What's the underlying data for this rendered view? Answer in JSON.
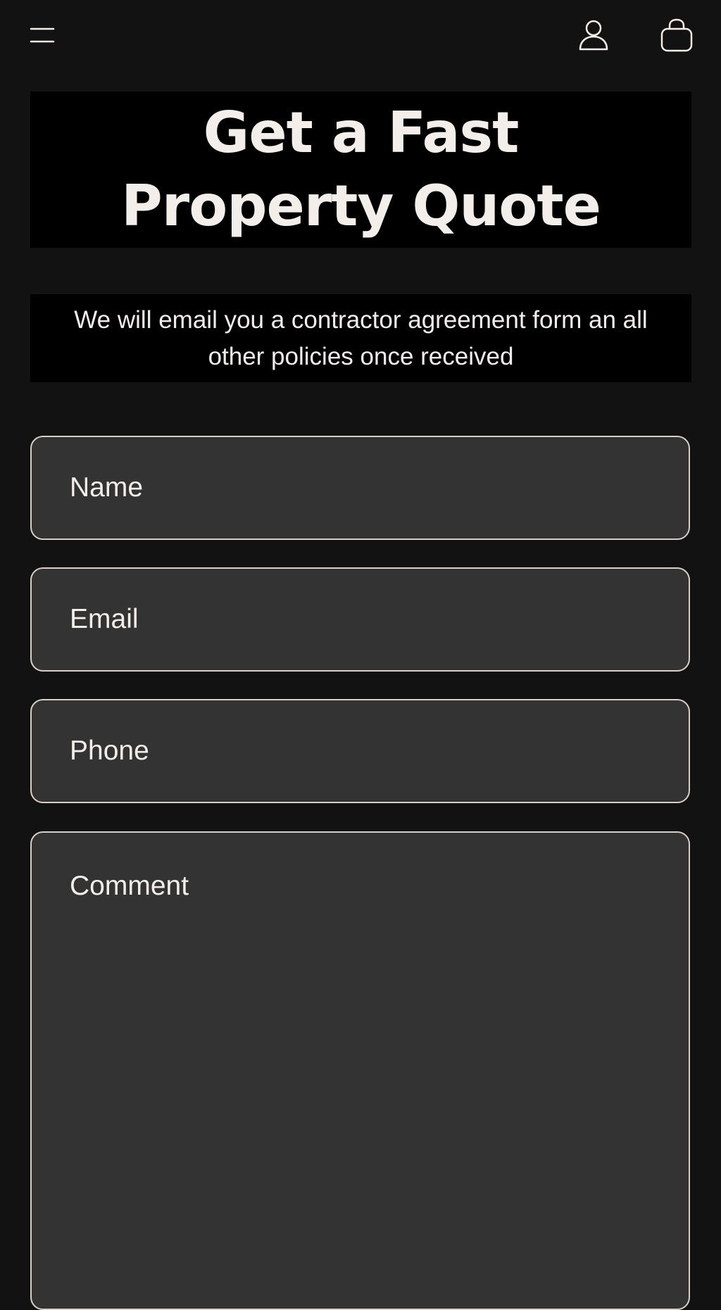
{
  "header": {
    "menu_icon": "hamburger-menu-icon",
    "account_icon": "user-account-icon",
    "cart_icon": "shopping-bag-icon"
  },
  "hero": {
    "title": "Get a Fast Property Quote",
    "subtitle": "We will email you a contractor agreement form an all other policies once received"
  },
  "form": {
    "name_placeholder": "Name",
    "email_placeholder": "Email",
    "phone_placeholder": "Phone",
    "comment_placeholder": "Comment"
  },
  "colors": {
    "page_background": "#121212",
    "banner_background": "#000000",
    "field_background": "#333333",
    "field_border": "#d8cfc8",
    "text": "#f3eeea"
  }
}
